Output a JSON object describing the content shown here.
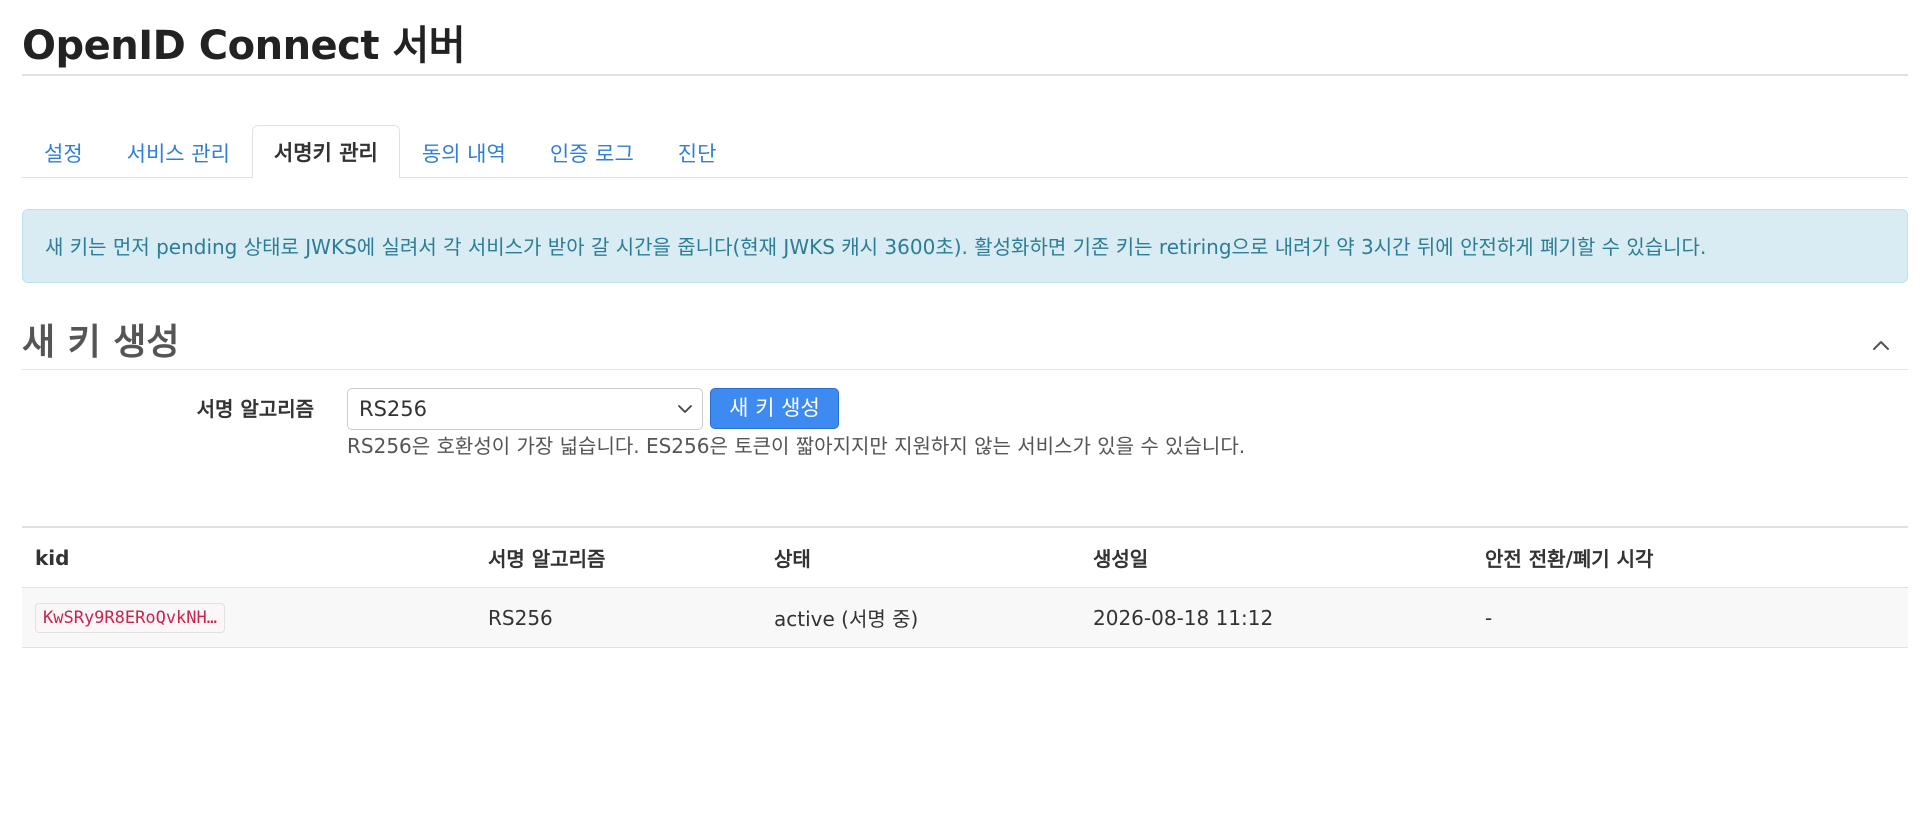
{
  "page": {
    "title": "OpenID Connect 서버"
  },
  "tabs": [
    {
      "label": "설정",
      "active": false
    },
    {
      "label": "서비스 관리",
      "active": false
    },
    {
      "label": "서명키 관리",
      "active": true
    },
    {
      "label": "동의 내역",
      "active": false
    },
    {
      "label": "인증 로그",
      "active": false
    },
    {
      "label": "진단",
      "active": false
    }
  ],
  "alert": {
    "text": "새 키는 먼저 pending 상태로 JWKS에 실려서 각 서비스가 받아 갈 시간을 줍니다(현재 JWKS 캐시 3600초). 활성화하면 기존 키는 retiring으로 내려가 약 3시간 뒤에 안전하게 폐기할 수 있습니다."
  },
  "new_key_section": {
    "title": "새 키 생성",
    "collapse_icon": "chevron-up-icon",
    "algorithm_label": "서명 알고리즘",
    "algorithm_selected": "RS256",
    "generate_button": "새 키 생성",
    "help_text": "RS256은 호환성이 가장 넓습니다. ES256은 토큰이 짧아지지만 지원하지 않는 서비스가 있을 수 있습니다."
  },
  "keys_table": {
    "headers": {
      "kid": "kid",
      "algorithm": "서명 알고리즘",
      "status": "상태",
      "created": "생성일",
      "retire_at": "안전 전환/폐기 시각"
    },
    "rows": [
      {
        "kid": "KwSRy9R8ERoQvkNH…",
        "algorithm": "RS256",
        "status": "active (서명 중)",
        "created": "2026-08-18 11:12",
        "retire_at": "-"
      }
    ]
  },
  "colors": {
    "link": "#2f7fd8",
    "primary_button": "#3d8bf0",
    "alert_bg": "#d9ecf3",
    "alert_text": "#2d7d96",
    "kid_code": "#c7254e"
  }
}
